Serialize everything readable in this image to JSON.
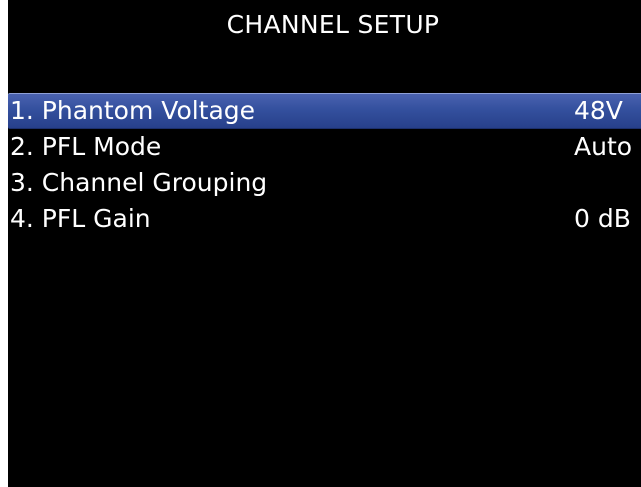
{
  "screen": {
    "title": "CHANNEL SETUP"
  },
  "menu": {
    "items": [
      {
        "label": "1. Phantom Voltage",
        "value": "48V"
      },
      {
        "label": "2. PFL Mode",
        "value": "Auto"
      },
      {
        "label": "3. Channel Grouping",
        "value": ""
      },
      {
        "label": "4. PFL Gain",
        "value": "0 dB"
      }
    ],
    "selected_index": 0
  },
  "colors": {
    "background": "#000000",
    "text": "#ffffff",
    "highlight": "#34509e"
  }
}
